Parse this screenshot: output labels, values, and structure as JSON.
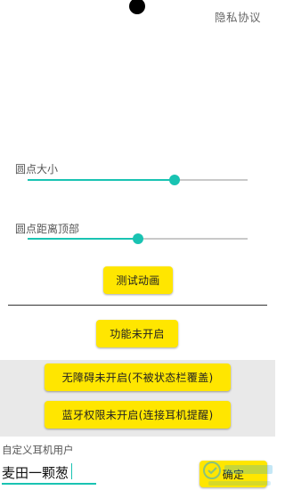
{
  "header": {
    "privacy_link": "隐私协议"
  },
  "dot_size": {
    "label": "圆点大小",
    "value_fraction": 0.67
  },
  "dot_top_distance": {
    "label": "圆点距离顶部",
    "value_fraction": 0.5
  },
  "buttons": {
    "test_animation": "测试动画",
    "feature_disabled": "功能未开启",
    "accessibility_disabled": "无障碍未开启(不被状态栏覆盖)",
    "bluetooth_disabled": "蓝牙权限未开启(连接耳机提醒)",
    "confirm": "确定"
  },
  "custom_user": {
    "label": "自定义耳机用户",
    "value": "麦田一颗葱"
  },
  "colors": {
    "accent": "#19c3b2",
    "button": "#ffe600",
    "panel": "#e9e9e9"
  }
}
